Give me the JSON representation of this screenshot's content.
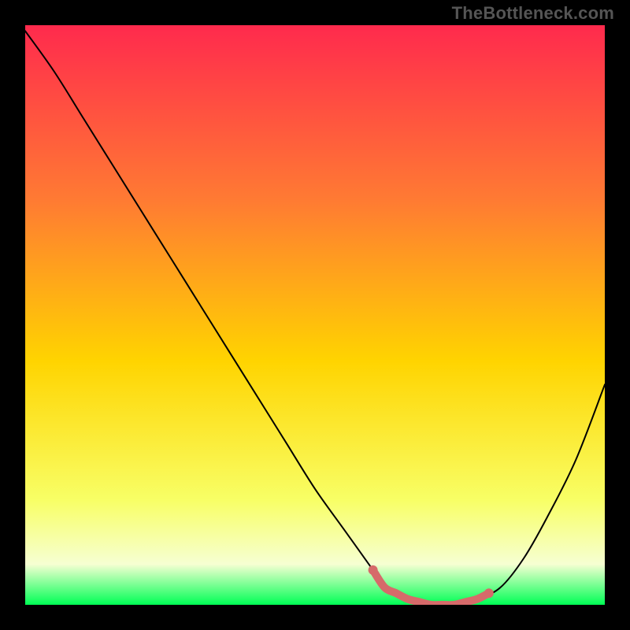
{
  "watermark": "TheBottleneck.com",
  "colors": {
    "background_black": "#000000",
    "gradient_top": "#ff2a4d",
    "gradient_mid_upper": "#ff7a33",
    "gradient_mid": "#ffd400",
    "gradient_lower": "#f8ff66",
    "gradient_pale": "#f6ffd2",
    "gradient_bottom": "#00ff55",
    "curve_stroke": "#000000",
    "trough_stroke": "#d66a6a"
  },
  "chart_data": {
    "type": "line",
    "title": "",
    "xlabel": "",
    "ylabel": "",
    "xlim": [
      0,
      100
    ],
    "ylim": [
      0,
      100
    ],
    "x": [
      0,
      5,
      10,
      15,
      20,
      25,
      30,
      35,
      40,
      45,
      50,
      55,
      60,
      62,
      66,
      70,
      74,
      78,
      82,
      86,
      90,
      95,
      100
    ],
    "values": [
      99,
      92,
      84,
      76,
      68,
      60,
      52,
      44,
      36,
      28,
      20,
      13,
      6,
      3,
      1,
      0,
      0,
      1,
      3,
      8,
      15,
      25,
      38
    ],
    "trough_region": {
      "x_start": 60,
      "x_end": 80
    },
    "notes": "Single V-shaped bottleneck curve over a vertical red→yellow→green heat gradient. Values are percentage-style (0 = bottom/green, 100 = top/red). No axis ticks or labels are rendered in the source image."
  }
}
